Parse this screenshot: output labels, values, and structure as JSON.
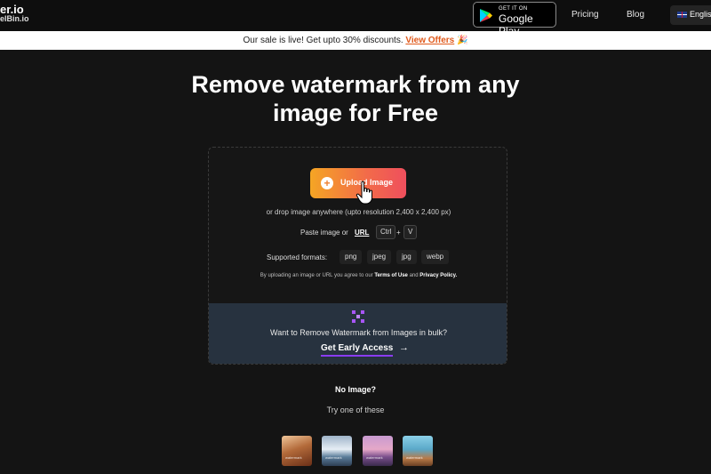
{
  "header": {
    "logo_line1": "er.io",
    "logo_line2": "elBin.io",
    "store_badge": {
      "small": "GET IT ON",
      "big": "Google Play"
    },
    "nav": [
      {
        "label": "Pricing"
      },
      {
        "label": "Blog"
      }
    ],
    "language": "English"
  },
  "promo": {
    "text": "Our sale is live! Get upto 30% discounts.",
    "link": "View Offers",
    "emoji": "🎉"
  },
  "hero": {
    "line1": "Remove watermark from any",
    "line2": "image for Free"
  },
  "upload": {
    "button_label": "Upload Image",
    "drop_text": "or drop image anywhere (upto resolution 2,400 x 2,400 px)",
    "paste_label": "Paste image or",
    "url_label": "URL",
    "key1": "Ctrl",
    "key_plus": "+",
    "key2": "V",
    "formats_label": "Supported formats:",
    "formats": [
      "png",
      "jpeg",
      "jpg",
      "webp"
    ],
    "terms_prefix": "By uploading an image or URL you agree to our",
    "terms_link": "Terms of Use",
    "terms_and": "and",
    "privacy_link": "Privacy Policy."
  },
  "bulk": {
    "question": "Want to Remove Watermark from Images in bulk?",
    "cta": "Get Early Access",
    "arrow": "→"
  },
  "samples": {
    "title": "No Image?",
    "subtitle": "Try one of these",
    "watermark_text": "watermark"
  },
  "colors": {
    "accent_gradient_start": "#f5a524",
    "accent_gradient_end": "#ef4f5d",
    "promo_link": "#e05a1c",
    "bulk_underline": "#8a3cf5"
  }
}
